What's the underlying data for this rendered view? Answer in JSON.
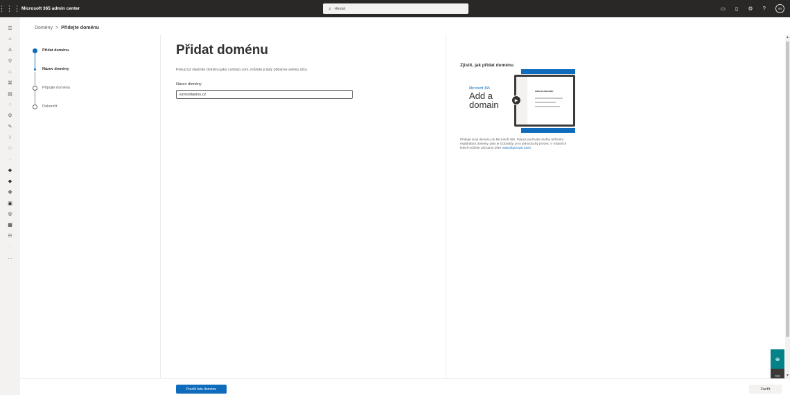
{
  "header": {
    "app_title": "Microsoft 365 admin center",
    "search_placeholder": "Hledat",
    "avatar_initials": "vh"
  },
  "breadcrumb": {
    "parent": "Domény",
    "separator": ">",
    "current": "Přidejte doménu"
  },
  "steps": [
    {
      "label": "Přidat doménu",
      "state": "active"
    },
    {
      "label": "Název domény",
      "state": "sub-active"
    },
    {
      "label": "Připojte doménu",
      "state": "pending"
    },
    {
      "label": "Dokončit",
      "state": "pending"
    }
  ],
  "main": {
    "title": "Přidat doménu",
    "description": "Pokud už vlastníte doménu jako contoso.com, můžete ji tady přidat ke svému účtu.",
    "field_label": "Název domény",
    "field_value": "ezmontanios.cz"
  },
  "help": {
    "title": "Zjistit, jak přidat doménu",
    "video_brand": "Microsoft 365",
    "video_line1": "Add a",
    "video_line2": "domain",
    "video_screen_title": "Add a domain",
    "text": "Přidejte svoji doménu do Microsoft 365. Pokud používáte služby běžného registrátora domény, jako je GoDaddy, je to jednoduchý proces. V ostatních letech můžete záznamy DNS",
    "link": "nakonfigurovat sami."
  },
  "footer": {
    "primary_button": "Použít tuto doménu",
    "close_button": "Zavřít"
  },
  "colors": {
    "accent": "#0f6cbd",
    "topbar": "#292827",
    "help_fab": "#038387"
  }
}
